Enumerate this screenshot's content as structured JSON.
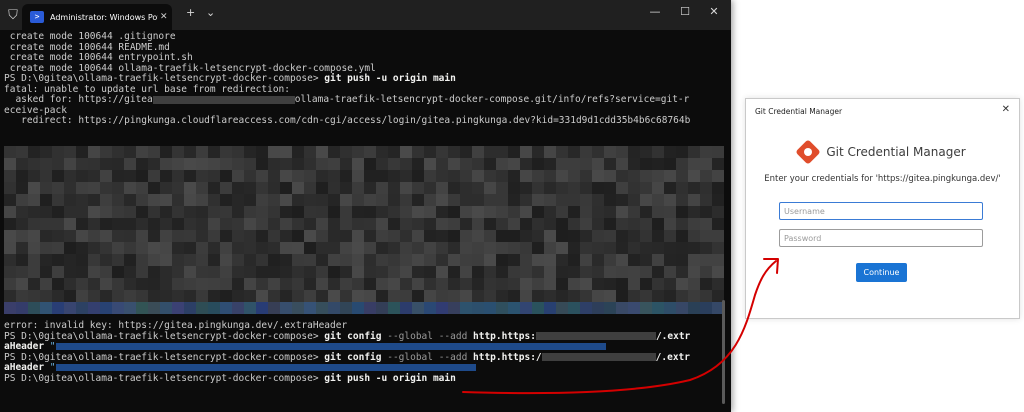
{
  "terminal": {
    "tab_title": "Administrator: Windows PowerShell",
    "tab_close_glyph": "✕",
    "new_tab_glyph": "+",
    "dropdown_glyph": "⌄",
    "minimize_glyph": "—",
    "maximize_glyph": "☐",
    "close_glyph": "✕",
    "lines": {
      "l1": " create mode 100644 .gitignore",
      "l2": " create mode 100644 README.md",
      "l3": " create mode 100644 entrypoint.sh",
      "l4": " create mode 100644 ollama-traefik-letsencrypt-docker-compose.yml",
      "l5_prompt": "PS D:\\0gitea\\ollama-traefik-letsencrypt-docker-compose> ",
      "l5_cmd": "git push -u origin main",
      "l6": "fatal: unable to update url base from redirection:",
      "l7_a": "  asked for: https://gitea",
      "l7_b": "ollama-traefik-letsencrypt-docker-compose.git/info/refs?service=git-r",
      "l8": "eceive-pack",
      "l9": "   redirect: https://pingkunga.cloudflareaccess.com/cdn-cgi/access/login/gitea.pingkunga.dev?kid=331d9d1cdd35b4b6c68764b",
      "l10": "error: invalid key: https://gitea.pingkunga.dev/.extraHeader",
      "l11_prompt": "PS D:\\0gitea\\ollama-traefik-letsencrypt-docker-compose> ",
      "l11_cmd": "git config",
      "l11_param": " --global --add ",
      "l11_key": "http.https:",
      "l11_end": "/.extr",
      "l12_a": "aHeader ",
      "l12_q": "\"",
      "l13_prompt": "PS D:\\0gitea\\ollama-traefik-letsencrypt-docker-compose> ",
      "l13_cmd": "git config",
      "l13_param": " --global --add ",
      "l13_key": "http.https:/",
      "l13_end": "/.extr",
      "l14_a": "aHeader ",
      "l14_q": "\"",
      "l15_prompt": "PS D:\\0gitea\\ollama-traefik-letsencrypt-docker-compose> ",
      "l15_cmd": "git push -u origin main"
    }
  },
  "dialog": {
    "window_title": "Git Credential Manager",
    "close_glyph": "✕",
    "app_name": "Git Credential Manager",
    "prompt": "Enter your credentials for 'https://gitea.pingkunga.dev/'",
    "username_placeholder": "Username",
    "password_placeholder": "Password",
    "continue_label": "Continue"
  },
  "colors": {
    "terminal_bg": "#0c0c0c",
    "accent_blue": "#1a74d4",
    "annotation_red": "#d40000"
  }
}
